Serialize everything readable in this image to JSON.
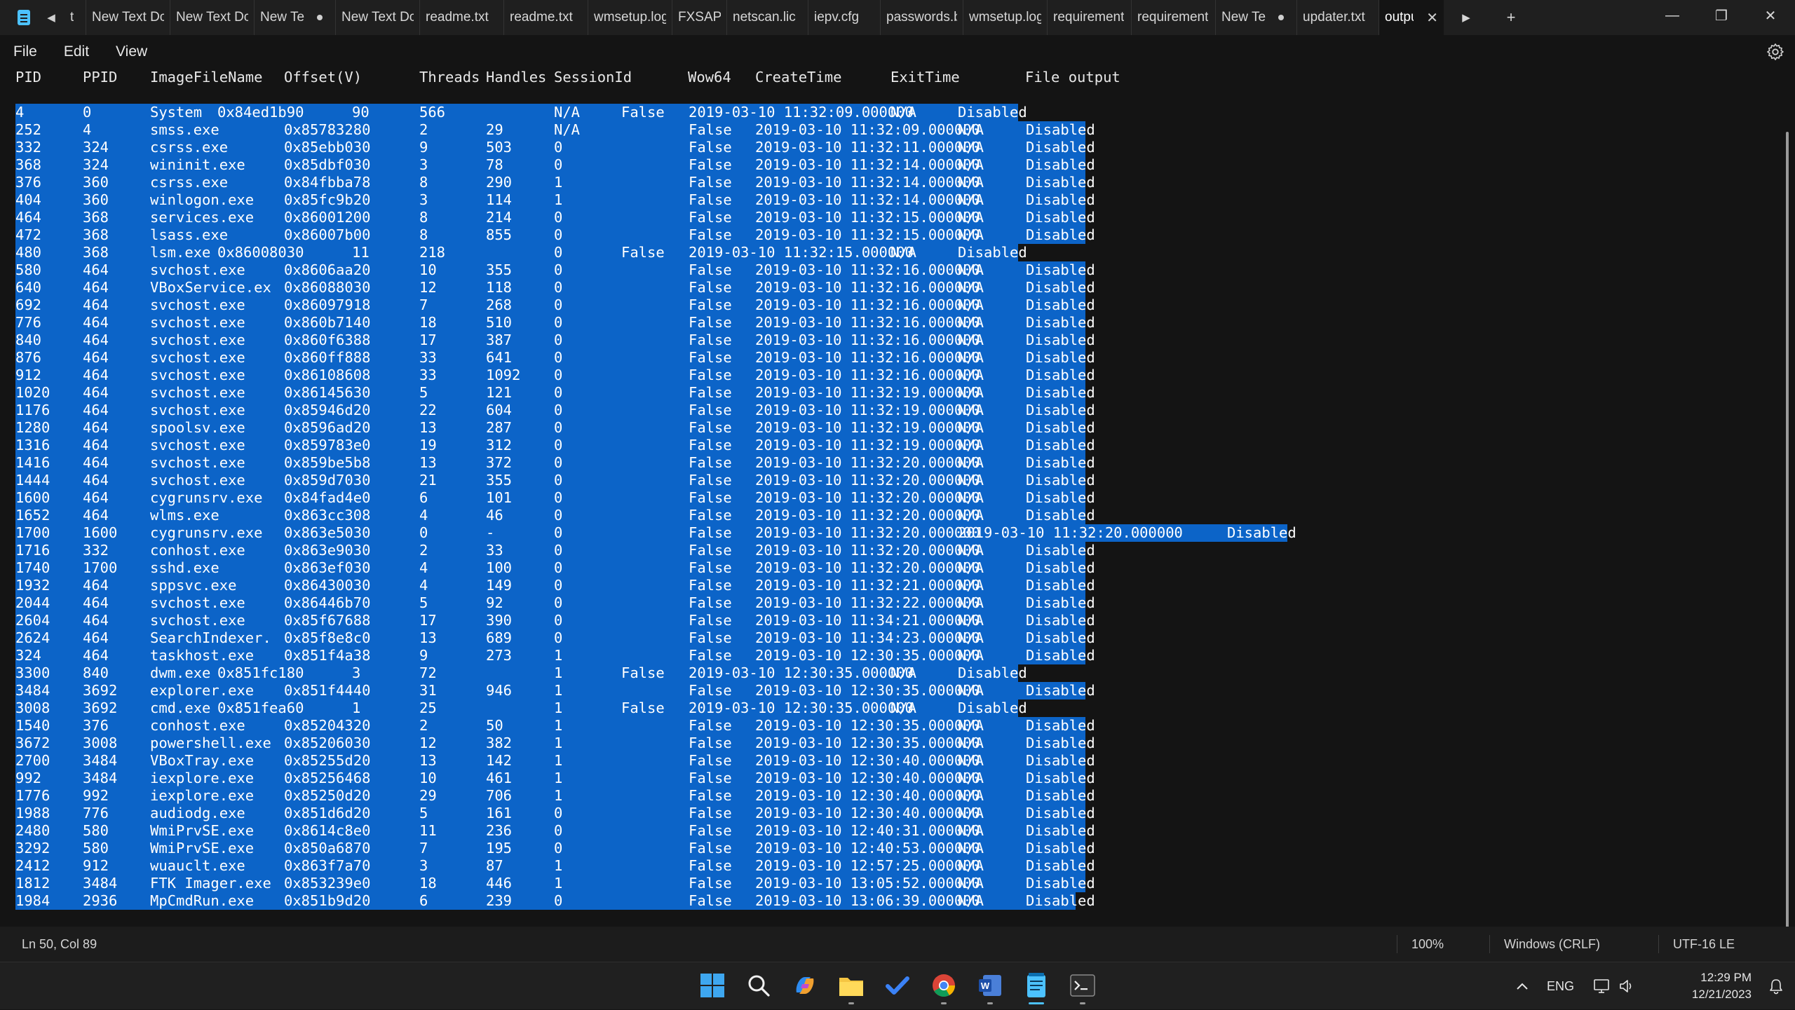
{
  "window": {
    "app_name": "Notepad",
    "tabs": [
      {
        "label": "t",
        "modified": false
      },
      {
        "label": "New Text Dc",
        "modified": false
      },
      {
        "label": "New Text Dc",
        "modified": false
      },
      {
        "label": "New Te",
        "modified": true
      },
      {
        "label": "New Text Dc",
        "modified": false
      },
      {
        "label": "readme.txt",
        "modified": false
      },
      {
        "label": "readme.txt",
        "modified": false
      },
      {
        "label": "wmsetup.log",
        "modified": false
      },
      {
        "label": "FXSAPIDebu",
        "modified": false
      },
      {
        "label": "netscan.lic",
        "modified": false
      },
      {
        "label": "iepv.cfg",
        "modified": false
      },
      {
        "label": "passwords.b",
        "modified": false
      },
      {
        "label": "wmsetup.log",
        "modified": false
      },
      {
        "label": "requirement",
        "modified": false
      },
      {
        "label": "requirement",
        "modified": false
      },
      {
        "label": "New Te",
        "modified": true
      },
      {
        "label": "updater.txt",
        "modified": false
      }
    ],
    "active_tab": {
      "label": "outpu",
      "close_glyph": "✕"
    },
    "tab_scroll_left": "◀",
    "tab_scroll_right": "▶",
    "new_tab": "+",
    "controls": {
      "minimize": "—",
      "maximize": "❐",
      "close": "✕"
    }
  },
  "menu": {
    "file": "File",
    "edit": "Edit",
    "view": "View"
  },
  "editor": {
    "header": {
      "pid": "PID",
      "ppid": "PPID",
      "image": "ImageFileName",
      "offset": "Offset(V)",
      "threads": "Threads",
      "handles": "Handles",
      "session": "SessionId",
      "wow64": "Wow64",
      "create": "CreateTime",
      "exit": "ExitTime",
      "file": "File output"
    },
    "rows": [
      {
        "t": "s",
        "c": [
          "4",
          "0",
          "System",
          "0x84ed1b90",
          "90",
          "566",
          "N/A",
          "False",
          "2019-03-10 11:32:09.000000",
          "N/A",
          "Disabled"
        ]
      },
      {
        "t": "n",
        "c": [
          "252",
          "4",
          "smss.exe",
          "0x85783280",
          "2",
          "29",
          "N/A",
          "False",
          "2019-03-10 11:32:09.000000",
          "N/A",
          "Disabled"
        ]
      },
      {
        "t": "n",
        "c": [
          "332",
          "324",
          "csrss.exe",
          "0x85ebb030",
          "9",
          "503",
          "0",
          "False",
          "2019-03-10 11:32:11.000000",
          "N/A",
          "Disabled"
        ]
      },
      {
        "t": "n",
        "c": [
          "368",
          "324",
          "wininit.exe",
          "0x85dbf030",
          "3",
          "78",
          "0",
          "False",
          "2019-03-10 11:32:14.000000",
          "N/A",
          "Disabled"
        ]
      },
      {
        "t": "n",
        "c": [
          "376",
          "360",
          "csrss.exe",
          "0x84fbba78",
          "8",
          "290",
          "1",
          "False",
          "2019-03-10 11:32:14.000000",
          "N/A",
          "Disabled"
        ]
      },
      {
        "t": "n",
        "c": [
          "404",
          "360",
          "winlogon.exe",
          "0x85fc9b20",
          "3",
          "114",
          "1",
          "False",
          "2019-03-10 11:32:14.000000",
          "N/A",
          "Disabled"
        ]
      },
      {
        "t": "n",
        "c": [
          "464",
          "368",
          "services.exe",
          "0x86001200",
          "8",
          "214",
          "0",
          "False",
          "2019-03-10 11:32:15.000000",
          "N/A",
          "Disabled"
        ]
      },
      {
        "t": "n",
        "c": [
          "472",
          "368",
          "lsass.exe",
          "0x86007b00",
          "8",
          "855",
          "0",
          "False",
          "2019-03-10 11:32:15.000000",
          "N/A",
          "Disabled"
        ]
      },
      {
        "t": "s",
        "c": [
          "480",
          "368",
          "lsm.exe",
          "0x86008030",
          "11",
          "218",
          "0",
          "False",
          "2019-03-10 11:32:15.000000",
          "N/A",
          "Disabled"
        ]
      },
      {
        "t": "n",
        "c": [
          "580",
          "464",
          "svchost.exe",
          "0x8606aa20",
          "10",
          "355",
          "0",
          "False",
          "2019-03-10 11:32:16.000000",
          "N/A",
          "Disabled"
        ]
      },
      {
        "t": "n",
        "c": [
          "640",
          "464",
          "VBoxService.ex",
          "0x86088030",
          "12",
          "118",
          "0",
          "False",
          "2019-03-10 11:32:16.000000",
          "N/A",
          "Disabled"
        ]
      },
      {
        "t": "n",
        "c": [
          "692",
          "464",
          "svchost.exe",
          "0x86097918",
          "7",
          "268",
          "0",
          "False",
          "2019-03-10 11:32:16.000000",
          "N/A",
          "Disabled"
        ]
      },
      {
        "t": "n",
        "c": [
          "776",
          "464",
          "svchost.exe",
          "0x860b7140",
          "18",
          "510",
          "0",
          "False",
          "2019-03-10 11:32:16.000000",
          "N/A",
          "Disabled"
        ]
      },
      {
        "t": "n",
        "c": [
          "840",
          "464",
          "svchost.exe",
          "0x860f6388",
          "17",
          "387",
          "0",
          "False",
          "2019-03-10 11:32:16.000000",
          "N/A",
          "Disabled"
        ]
      },
      {
        "t": "n",
        "c": [
          "876",
          "464",
          "svchost.exe",
          "0x860ff888",
          "33",
          "641",
          "0",
          "False",
          "2019-03-10 11:32:16.000000",
          "N/A",
          "Disabled"
        ]
      },
      {
        "t": "n",
        "c": [
          "912",
          "464",
          "svchost.exe",
          "0x86108608",
          "33",
          "1092",
          "0",
          "False",
          "2019-03-10 11:32:16.000000",
          "N/A",
          "Disabled"
        ]
      },
      {
        "t": "n",
        "c": [
          "1020",
          "464",
          "svchost.exe",
          "0x86145630",
          "5",
          "121",
          "0",
          "False",
          "2019-03-10 11:32:19.000000",
          "N/A",
          "Disabled"
        ]
      },
      {
        "t": "n",
        "c": [
          "1176",
          "464",
          "svchost.exe",
          "0x85946d20",
          "22",
          "604",
          "0",
          "False",
          "2019-03-10 11:32:19.000000",
          "N/A",
          "Disabled"
        ]
      },
      {
        "t": "n",
        "c": [
          "1280",
          "464",
          "spoolsv.exe",
          "0x8596ad20",
          "13",
          "287",
          "0",
          "False",
          "2019-03-10 11:32:19.000000",
          "N/A",
          "Disabled"
        ]
      },
      {
        "t": "n",
        "c": [
          "1316",
          "464",
          "svchost.exe",
          "0x859783e0",
          "19",
          "312",
          "0",
          "False",
          "2019-03-10 11:32:19.000000",
          "N/A",
          "Disabled"
        ]
      },
      {
        "t": "n",
        "c": [
          "1416",
          "464",
          "svchost.exe",
          "0x859be5b8",
          "13",
          "372",
          "0",
          "False",
          "2019-03-10 11:32:20.000000",
          "N/A",
          "Disabled"
        ]
      },
      {
        "t": "n",
        "c": [
          "1444",
          "464",
          "svchost.exe",
          "0x859d7030",
          "21",
          "355",
          "0",
          "False",
          "2019-03-10 11:32:20.000000",
          "N/A",
          "Disabled"
        ]
      },
      {
        "t": "n",
        "c": [
          "1600",
          "464",
          "cygrunsrv.exe",
          "0x84fad4e0",
          "6",
          "101",
          "0",
          "False",
          "2019-03-10 11:32:20.000000",
          "N/A",
          "Disabled"
        ]
      },
      {
        "t": "n",
        "c": [
          "1652",
          "464",
          "wlms.exe",
          "0x863cc308",
          "4",
          "46",
          "0",
          "False",
          "2019-03-10 11:32:20.000000",
          "N/A",
          "Disabled"
        ]
      },
      {
        "t": "x",
        "c": [
          "1700",
          "1600",
          "cygrunsrv.exe",
          "0x863e5030",
          "0",
          "-",
          "0",
          "False",
          "2019-03-10 11:32:20.000000",
          "2019-03-10 11:32:20.000000",
          "Disabled"
        ]
      },
      {
        "t": "n",
        "c": [
          "1716",
          "332",
          "conhost.exe",
          "0x863e9030",
          "2",
          "33",
          "0",
          "False",
          "2019-03-10 11:32:20.000000",
          "N/A",
          "Disabled"
        ]
      },
      {
        "t": "n",
        "c": [
          "1740",
          "1700",
          "sshd.exe",
          "0x863ef030",
          "4",
          "100",
          "0",
          "False",
          "2019-03-10 11:32:20.000000",
          "N/A",
          "Disabled"
        ]
      },
      {
        "t": "n",
        "c": [
          "1932",
          "464",
          "sppsvc.exe",
          "0x86430030",
          "4",
          "149",
          "0",
          "False",
          "2019-03-10 11:32:21.000000",
          "N/A",
          "Disabled"
        ]
      },
      {
        "t": "n",
        "c": [
          "2044",
          "464",
          "svchost.exe",
          "0x86446b70",
          "5",
          "92",
          "0",
          "False",
          "2019-03-10 11:32:22.000000",
          "N/A",
          "Disabled"
        ]
      },
      {
        "t": "n",
        "c": [
          "2604",
          "464",
          "svchost.exe",
          "0x85f67688",
          "17",
          "390",
          "0",
          "False",
          "2019-03-10 11:34:21.000000",
          "N/A",
          "Disabled"
        ]
      },
      {
        "t": "n",
        "c": [
          "2624",
          "464",
          "SearchIndexer.",
          "0x85f8e8c0",
          "13",
          "689",
          "0",
          "False",
          "2019-03-10 11:34:23.000000",
          "N/A",
          "Disabled"
        ]
      },
      {
        "t": "n",
        "c": [
          "324",
          "464",
          "taskhost.exe",
          "0x851f4a38",
          "9",
          "273",
          "1",
          "False",
          "2019-03-10 12:30:35.000000",
          "N/A",
          "Disabled"
        ]
      },
      {
        "t": "s",
        "c": [
          "3300",
          "840",
          "dwm.exe",
          "0x851fc180",
          "3",
          "72",
          "1",
          "False",
          "2019-03-10 12:30:35.000000",
          "N/A",
          "Disabled"
        ]
      },
      {
        "t": "n",
        "c": [
          "3484",
          "3692",
          "explorer.exe",
          "0x851f4440",
          "31",
          "946",
          "1",
          "False",
          "2019-03-10 12:30:35.000000",
          "N/A",
          "Disabled"
        ]
      },
      {
        "t": "s",
        "c": [
          "3008",
          "3692",
          "cmd.exe",
          "0x851fea60",
          "1",
          "25",
          "1",
          "False",
          "2019-03-10 12:30:35.000000",
          "N/A",
          "Disabled"
        ]
      },
      {
        "t": "n",
        "c": [
          "1540",
          "376",
          "conhost.exe",
          "0x85204320",
          "2",
          "50",
          "1",
          "False",
          "2019-03-10 12:30:35.000000",
          "N/A",
          "Disabled"
        ]
      },
      {
        "t": "n",
        "c": [
          "3672",
          "3008",
          "powershell.exe",
          "0x85206030",
          "12",
          "382",
          "1",
          "False",
          "2019-03-10 12:30:35.000000",
          "N/A",
          "Disabled"
        ]
      },
      {
        "t": "n",
        "c": [
          "2700",
          "3484",
          "VBoxTray.exe",
          "0x85255d20",
          "13",
          "142",
          "1",
          "False",
          "2019-03-10 12:30:40.000000",
          "N/A",
          "Disabled"
        ]
      },
      {
        "t": "n",
        "c": [
          "992",
          "3484",
          "iexplore.exe",
          "0x85256468",
          "10",
          "461",
          "1",
          "False",
          "2019-03-10 12:30:40.000000",
          "N/A",
          "Disabled"
        ]
      },
      {
        "t": "n",
        "c": [
          "1776",
          "992",
          "iexplore.exe",
          "0x85250d20",
          "29",
          "706",
          "1",
          "False",
          "2019-03-10 12:30:40.000000",
          "N/A",
          "Disabled"
        ]
      },
      {
        "t": "n",
        "c": [
          "1988",
          "776",
          "audiodg.exe",
          "0x851d6d20",
          "5",
          "161",
          "0",
          "False",
          "2019-03-10 12:30:40.000000",
          "N/A",
          "Disabled"
        ]
      },
      {
        "t": "n",
        "c": [
          "2480",
          "580",
          "WmiPrvSE.exe",
          "0x8614c8e0",
          "11",
          "236",
          "0",
          "False",
          "2019-03-10 12:40:31.000000",
          "N/A",
          "Disabled"
        ]
      },
      {
        "t": "n",
        "c": [
          "3292",
          "580",
          "WmiPrvSE.exe",
          "0x850a6870",
          "7",
          "195",
          "0",
          "False",
          "2019-03-10 12:40:53.000000",
          "N/A",
          "Disabled"
        ]
      },
      {
        "t": "n",
        "c": [
          "2412",
          "912",
          "wuauclt.exe",
          "0x863f7a70",
          "3",
          "87",
          "1",
          "False",
          "2019-03-10 12:57:25.000000",
          "N/A",
          "Disabled"
        ]
      },
      {
        "t": "n",
        "c": [
          "1812",
          "3484",
          "FTK Imager.exe",
          "0x853239e0",
          "18",
          "446",
          "1",
          "False",
          "2019-03-10 13:05:52.000000",
          "N/A",
          "Disabled"
        ]
      },
      {
        "t": "e",
        "c": [
          "1984",
          "2936",
          "MpCmdRun.exe",
          "0x851b9d20",
          "6",
          "239",
          "0",
          "False",
          "2019-03-10 13:06:39.000000",
          "N/A",
          "Disabled"
        ]
      }
    ]
  },
  "status": {
    "position": "Ln 50, Col 89",
    "zoom": "100%",
    "line_ending": "Windows (CRLF)",
    "encoding": "UTF-16 LE"
  },
  "taskbar": {
    "icons": [
      "windows-start-icon",
      "search-icon",
      "copilot-icon",
      "file-explorer-icon",
      "todo-icon",
      "chrome-icon",
      "word-icon",
      "notepad-icon",
      "terminal-icon"
    ],
    "tray": {
      "language": "ENG",
      "time": "12:29 PM",
      "date": "12/21/2023",
      "chevron": "^"
    }
  },
  "colors": {
    "selection": "#0c64c8",
    "accent": "#4cc2ff",
    "background": "#141414"
  }
}
